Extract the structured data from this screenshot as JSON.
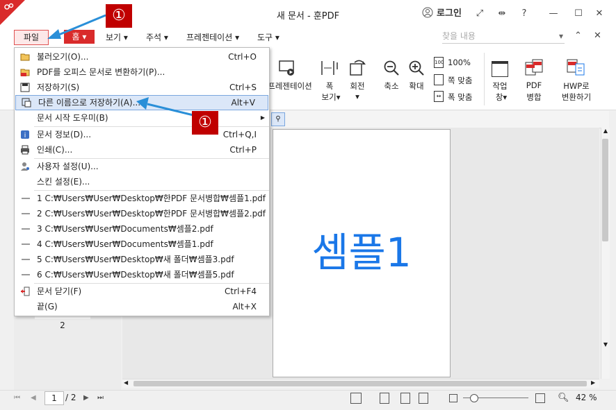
{
  "window": {
    "title": "새 문서 - 훈PDF",
    "login_label": "로그인",
    "help_label": "?",
    "controls": [
      "—",
      "☐",
      "✕"
    ]
  },
  "menubar": {
    "file": "파일",
    "home": "홈",
    "items": [
      {
        "label": "보기"
      },
      {
        "label": "주석"
      },
      {
        "label": "프레젠테이션"
      },
      {
        "label": "도구"
      }
    ],
    "search_placeholder": "찾을 내용"
  },
  "ribbon": {
    "presentation": "프레젠테이션",
    "width_view": [
      "폭",
      "보기"
    ],
    "rotate": "회전",
    "shrink": "축소",
    "enlarge": "확대",
    "zoom100": "100%",
    "fit_width": "쪽 맞춤",
    "fit_page": "폭 맞춤",
    "work_window": [
      "작업",
      "창"
    ],
    "pdf_merge": [
      "PDF",
      "병합"
    ],
    "hwp_convert": [
      "HWP로",
      "변환하기"
    ]
  },
  "dropdown": {
    "items": [
      {
        "label": "불러오기(O)...",
        "shortcut": "Ctrl+O"
      },
      {
        "label": "PDF를 오피스 문서로 변환하기(P)...",
        "shortcut": ""
      },
      {
        "label": "저장하기(S)",
        "shortcut": "Ctrl+S"
      },
      {
        "label": "다른 이름으로 저장하기(A)...",
        "shortcut": "Alt+V"
      },
      {
        "label": "문서 시작 도우미(B)",
        "shortcut": ""
      },
      {
        "label": "문서 정보(D)...",
        "shortcut": "Ctrl+Q,I"
      },
      {
        "label": "인쇄(C)...",
        "shortcut": "Ctrl+P"
      },
      {
        "label": "사용자 설정(U)...",
        "shortcut": ""
      },
      {
        "label": "스킨 설정(E)...",
        "shortcut": ""
      }
    ],
    "recent": [
      "1 C:₩Users₩User₩Desktop₩한PDF 문서병합₩셈플1.pdf",
      "2 C:₩Users₩User₩Desktop₩한PDF 문서병합₩셈플2.pdf",
      "3 C:₩Users₩User₩Documents₩셈플2.pdf",
      "4 C:₩Users₩User₩Documents₩셈플1.pdf",
      "5 C:₩Users₩User₩Desktop₩새 폴더₩셈플3.pdf",
      "6 C:₩Users₩User₩Desktop₩새 폴더₩셈플5.pdf"
    ],
    "close_doc": {
      "label": "문서 닫기(F)",
      "shortcut": "Ctrl+F4"
    },
    "exit": {
      "label": "끝(G)",
      "shortcut": "Alt+X"
    }
  },
  "badges": [
    "①",
    "①"
  ],
  "document": {
    "page_text": "셈플1",
    "thumb_page_number": "2"
  },
  "statusbar": {
    "page_current": "1",
    "page_total": "/ 2",
    "zoom": "42 %"
  },
  "colors": {
    "accent_red": "#d92b2b",
    "badge_red": "#c00000",
    "highlight_blue": "#1a77e8",
    "arrow_blue": "#2a8fd8"
  }
}
